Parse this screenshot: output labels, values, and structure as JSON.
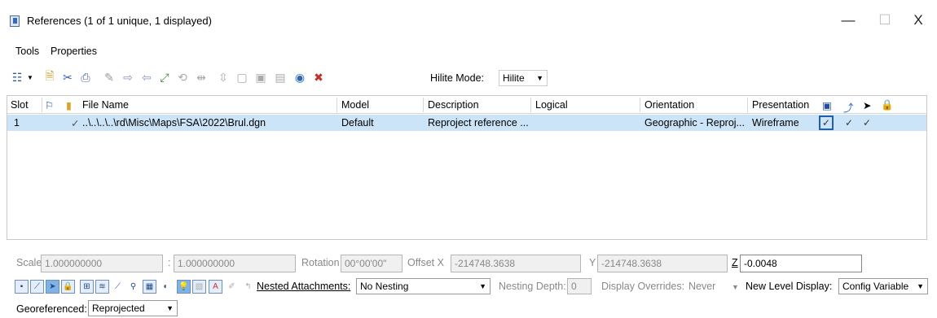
{
  "window": {
    "title": "References (1 of 1 unique, 1 displayed)",
    "min": "—",
    "max": "☐",
    "close": "X"
  },
  "menu": {
    "tools": "Tools",
    "properties": "Properties"
  },
  "toolbar": {
    "hilite_label": "Hilite Mode:",
    "hilite_value": "Hilite"
  },
  "table": {
    "headers": {
      "slot": "Slot",
      "file": "File Name",
      "model": "Model",
      "description": "Description",
      "logical": "Logical",
      "orientation": "Orientation",
      "presentation": "Presentation"
    },
    "row": {
      "slot": "1",
      "display_check": "✓",
      "file": "..\\..\\..\\..\\rd\\Misc\\Maps\\FSA\\2022\\Brul.dgn",
      "model": "Default",
      "description": "Reproject reference ...",
      "logical": "",
      "orientation": "Geographic - Reproj...",
      "presentation": "Wireframe",
      "check1": "✓",
      "check2": "✓",
      "check3": "✓"
    }
  },
  "fields": {
    "scale_label": "Scale",
    "scale1": "1.000000000",
    "colon": ":",
    "scale2": "1.000000000",
    "rotation_label": "Rotation",
    "rotation": "00°00'00\"",
    "offsetx_label": "Offset X",
    "offsetx": "-214748.3638",
    "y_label": "Y",
    "y": "-214748.3638",
    "z_label": "Z",
    "z": "-0.0048"
  },
  "options": {
    "nested_label": "Nested Attachments:",
    "nested_value": "No Nesting",
    "depth_label": "Nesting Depth:",
    "depth_value": "0",
    "overrides_label": "Display Overrides:",
    "overrides_value": "Never",
    "newlevel_label": "New Level Display:",
    "newlevel_value": "Config Variable",
    "geo_label": "Georeferenced:",
    "geo_value": "Reprojected"
  }
}
